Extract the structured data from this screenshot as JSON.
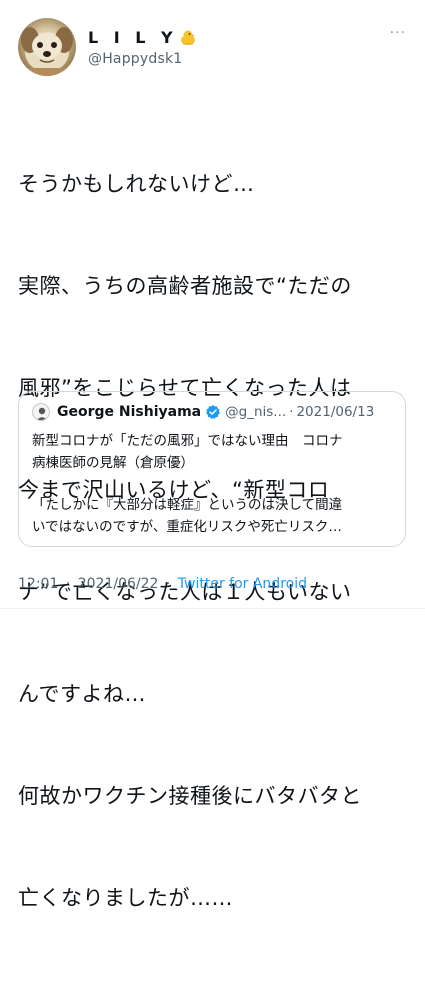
{
  "author": {
    "display_name": "L I L Y",
    "name_emoji": "chick-emoji",
    "handle": "@Happydsk1"
  },
  "tweet": {
    "lines": [
      "そうかもしれないけど…",
      "実際、うちの高齢者施設で“ただの",
      "風邪”をこじらせて亡くなった人は",
      "今まで沢山いるけど、“新型コロ",
      "ナ”で亡くなった人は１人もいない",
      "んですよね…",
      "何故かワクチン接種後にバタバタと",
      "亡くなりましたが……"
    ]
  },
  "quoted": {
    "name": "George Nishiyama",
    "verified": true,
    "handle": "@g_nis...",
    "separator": "·",
    "date": "2021/06/13",
    "lines": [
      "新型コロナが「ただの風邪」ではない理由　コロナ",
      "病棟医師の見解（倉原優）"
    ],
    "excerpt_lines": [
      "「たしかに『大部分は軽症』というのは決して間違",
      "いではないのですが、重症化リスクや死亡リスク…"
    ]
  },
  "meta": {
    "time": "12:01",
    "dot": "·",
    "date": "2021/06/22",
    "dot2": "·",
    "source": "Twitter for Android"
  },
  "colors": {
    "text": "#0f1419",
    "secondary": "#536471",
    "link": "#1d9bf0",
    "border": "#cfd9de"
  }
}
